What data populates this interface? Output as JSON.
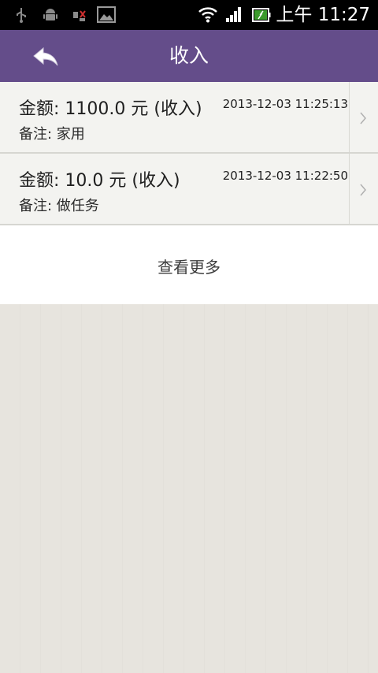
{
  "status_bar": {
    "time": "上午 11:27",
    "icons": [
      "usb-icon",
      "android-icon",
      "sim-icon",
      "gallery-icon",
      "wifi-icon",
      "signal-icon",
      "battery-icon"
    ]
  },
  "header": {
    "title": "收入",
    "back_icon": "back-arrow-icon",
    "color": "#644d8a"
  },
  "records": [
    {
      "amount": "金额: 1100.0 元 (收入)",
      "time": "2013-12-03 11:25:13",
      "note": "备注: 家用"
    },
    {
      "amount": "金额: 10.0 元 (收入)",
      "time": "2013-12-03 11:22:50",
      "note": "备注: 做任务"
    }
  ],
  "more": {
    "label": "查看更多"
  }
}
